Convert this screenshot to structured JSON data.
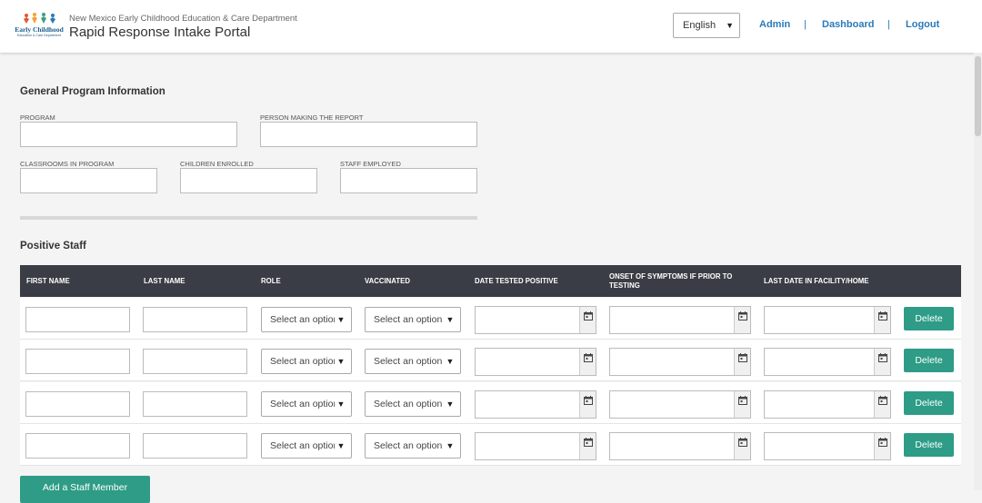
{
  "header": {
    "logo_line1": "Early Childhood",
    "logo_line2": "Education & Care Department",
    "agency_name": "New Mexico Early Childhood Education & Care Department",
    "portal_title": "Rapid Response Intake Portal",
    "language": "English",
    "nav": {
      "admin": "Admin",
      "dashboard": "Dashboard",
      "logout": "Logout",
      "separator": "|"
    }
  },
  "general": {
    "title": "General Program Information",
    "program_label": "PROGRAM",
    "person_label": "PERSON MAKING THE REPORT",
    "classrooms_label": "CLASSROOMS IN PROGRAM",
    "children_label": "CHILDREN ENROLLED",
    "staff_label": "STAFF EMPLOYED"
  },
  "staff": {
    "title": "Positive Staff",
    "columns": {
      "first_name": "FIRST NAME",
      "last_name": "LAST NAME",
      "role": "ROLE",
      "vaccinated": "VACCINATED",
      "date_tested": "DATE TESTED POSITIVE",
      "onset_line1": "ONSET OF SYMPTOMS IF PRIOR TO",
      "onset_line2": "TESTING",
      "last_date": "LAST DATE IN FACILITY/HOME"
    },
    "select_placeholder": "Select an option",
    "delete_label": "Delete",
    "rows": [
      {},
      {},
      {},
      {}
    ],
    "add_label": "Add a Staff Member"
  },
  "colors": {
    "accent_button": "#2e9c86",
    "link": "#2a7ab8",
    "table_header": "#3a3d45"
  }
}
